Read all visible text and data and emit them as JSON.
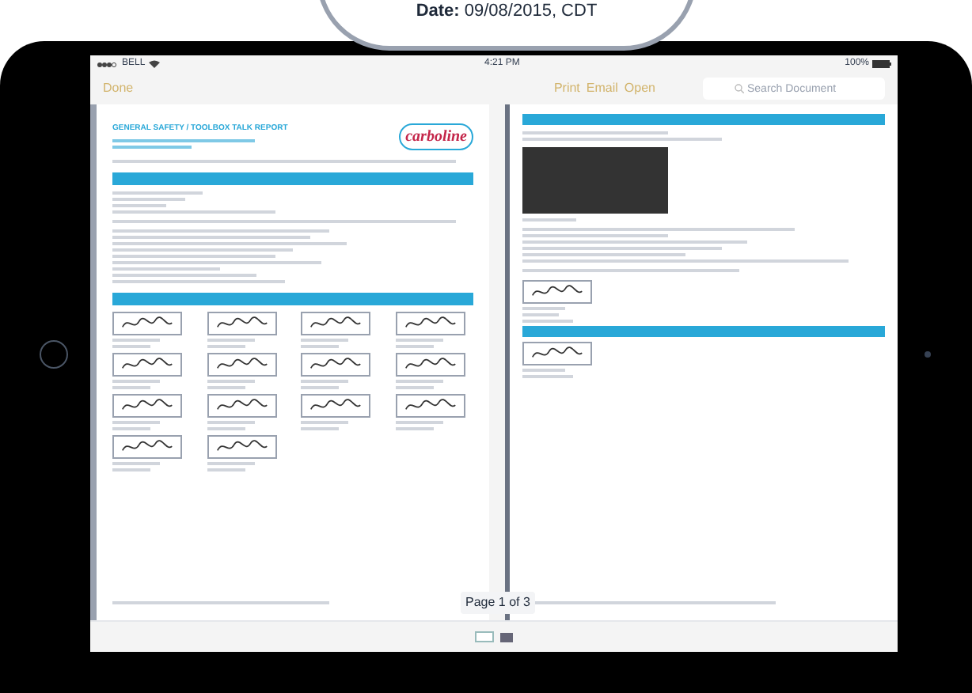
{
  "magnifier": {
    "label": "Date:",
    "value": "09/08/2015, CDT"
  },
  "status_bar": {
    "carrier": "BELL",
    "time": "4:21 PM",
    "battery": "100%"
  },
  "toolbar": {
    "done": "Done",
    "actions": [
      "Print",
      "Email",
      "Open"
    ],
    "search": {
      "placeholder": "Search Document"
    }
  },
  "left_page": {
    "title": "GENERAL SAFETY / TOOLBOX TALK REPORT",
    "logo": "carboline"
  },
  "page_indicator": "Page 1 of 3"
}
